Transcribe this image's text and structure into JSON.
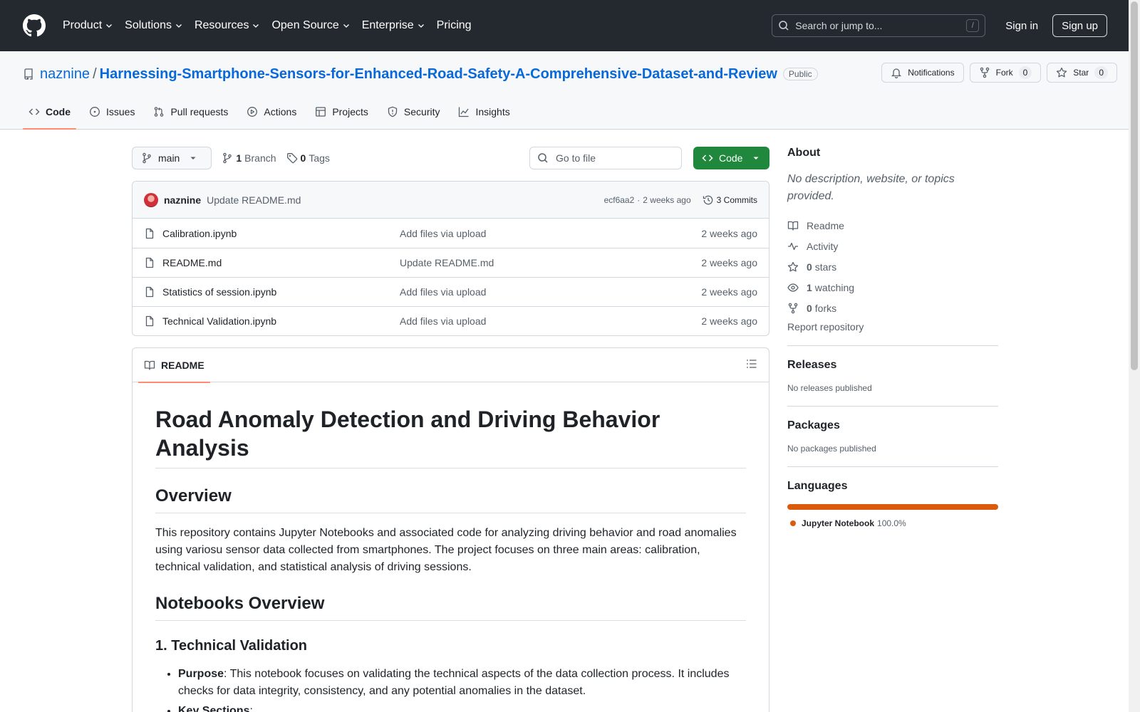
{
  "header": {
    "nav": [
      {
        "label": "Product",
        "has_menu": true
      },
      {
        "label": "Solutions",
        "has_menu": true
      },
      {
        "label": "Resources",
        "has_menu": true
      },
      {
        "label": "Open Source",
        "has_menu": true
      },
      {
        "label": "Enterprise",
        "has_menu": true
      },
      {
        "label": "Pricing",
        "has_menu": false
      }
    ],
    "search_placeholder": "Search or jump to...",
    "search_shortcut": "/",
    "sign_in": "Sign in",
    "sign_up": "Sign up"
  },
  "repo": {
    "owner": "naznine",
    "separator": "/",
    "name": "Harnessing-Smartphone-Sensors-for-Enhanced-Road-Safety-A-Comprehensive-Dataset-and-Review",
    "visibility": "Public",
    "actions": {
      "notifications": "Notifications",
      "fork": "Fork",
      "fork_count": "0",
      "star": "Star",
      "star_count": "0"
    },
    "tabs": [
      {
        "label": "Code",
        "icon": "code-icon",
        "active": true
      },
      {
        "label": "Issues",
        "icon": "issue-icon",
        "active": false
      },
      {
        "label": "Pull requests",
        "icon": "pull-request-icon",
        "active": false
      },
      {
        "label": "Actions",
        "icon": "play-icon",
        "active": false
      },
      {
        "label": "Projects",
        "icon": "table-icon",
        "active": false
      },
      {
        "label": "Security",
        "icon": "shield-icon",
        "active": false
      },
      {
        "label": "Insights",
        "icon": "graph-icon",
        "active": false
      }
    ]
  },
  "file_nav": {
    "branch": "main",
    "branch_count": "1",
    "branch_label": "Branch",
    "tag_count": "0",
    "tag_label": "Tags",
    "goto_placeholder": "Go to file",
    "code_button": "Code"
  },
  "latest_commit": {
    "author": "naznine",
    "message": "Update README.md",
    "hash": "ecf6aa2",
    "dot": "·",
    "age": "2 weeks ago",
    "commits": "3 Commits"
  },
  "files": [
    {
      "name": "Calibration.ipynb",
      "commit": "Add files via upload",
      "age": "2 weeks ago"
    },
    {
      "name": "README.md",
      "commit": "Update README.md",
      "age": "2 weeks ago"
    },
    {
      "name": "Statistics of session.ipynb",
      "commit": "Add files via upload",
      "age": "2 weeks ago"
    },
    {
      "name": "Technical Validation.ipynb",
      "commit": "Add files via upload",
      "age": "2 weeks ago"
    }
  ],
  "readme": {
    "tab_label": "README",
    "title": "Road Anomaly Detection and Driving Behavior Analysis",
    "overview_heading": "Overview",
    "overview_text": "This repository contains Jupyter Notebooks and associated code for analyzing driving behavior and road anomalies using variosu sensor data collected from smartphones. The project focuses on three main areas: calibration, technical validation, and statistical analysis of driving sessions.",
    "notebooks_heading": "Notebooks Overview",
    "section1_heading": "1. Technical Validation",
    "purpose_label": "Purpose",
    "purpose_text": ": This notebook focuses on validating the technical aspects of the data collection process. It includes checks for data integrity, consistency, and any potential anomalies in the dataset.",
    "key_sections_label": "Key Sections",
    "key_sections_suffix": ":"
  },
  "sidebar": {
    "about_heading": "About",
    "about_desc": "No description, website, or topics provided.",
    "links": [
      {
        "icon": "book-icon",
        "count": "",
        "label": "Readme"
      },
      {
        "icon": "pulse-icon",
        "count": "",
        "label": "Activity"
      },
      {
        "icon": "star-icon",
        "count": "0",
        "label": "stars"
      },
      {
        "icon": "eye-icon",
        "count": "1",
        "label": "watching"
      },
      {
        "icon": "fork-icon",
        "count": "0",
        "label": "forks"
      }
    ],
    "report": "Report repository",
    "releases_heading": "Releases",
    "releases_text": "No releases published",
    "packages_heading": "Packages",
    "packages_text": "No packages published",
    "languages_heading": "Languages",
    "languages": [
      {
        "name": "Jupyter Notebook",
        "percent": "100.0%",
        "color": "#da5b0b"
      }
    ]
  },
  "colors": {
    "header_bg": "#24292f",
    "link": "#0969da",
    "primary_button": "#1f883d",
    "active_tab_underline": "#fd8c73",
    "jupyter": "#da5b0b"
  }
}
